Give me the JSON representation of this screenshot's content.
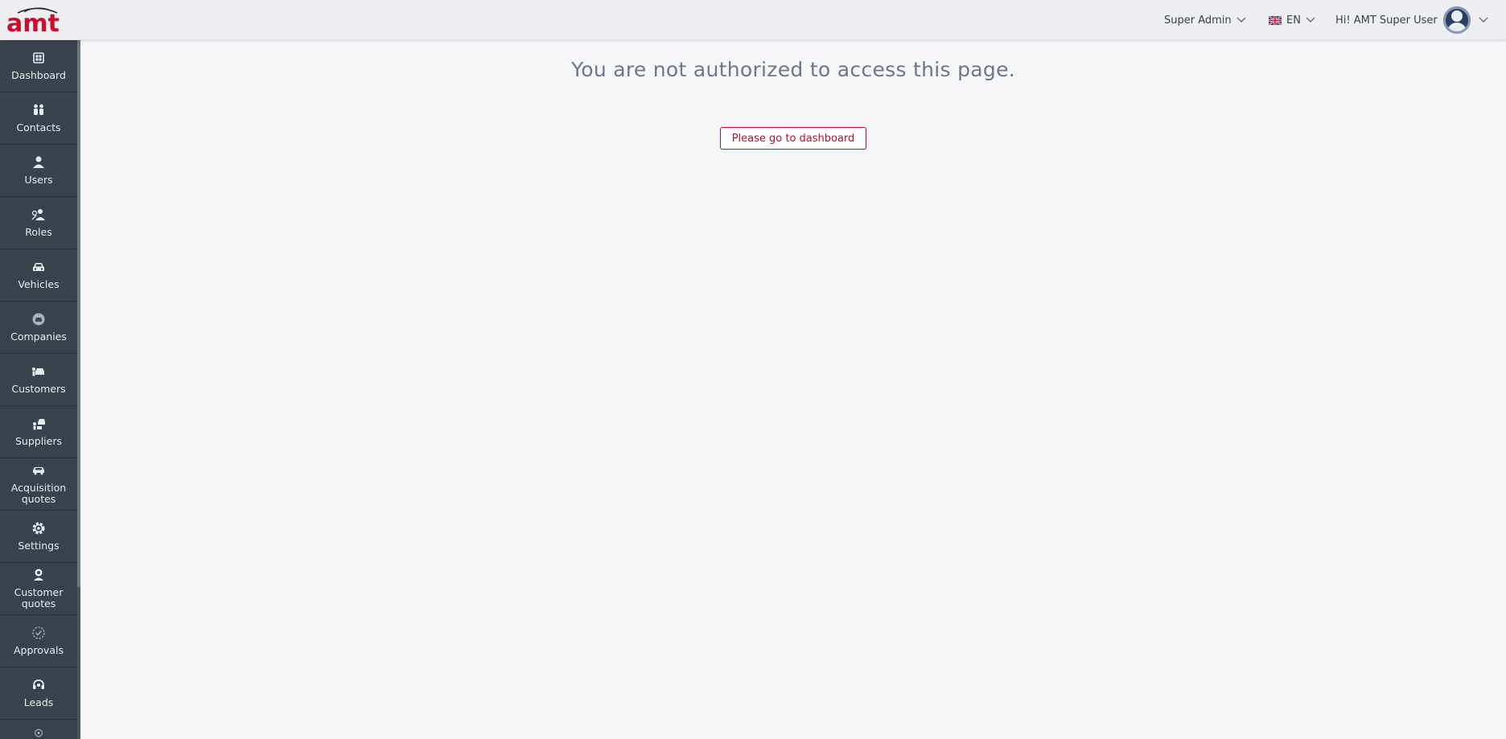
{
  "header": {
    "logo_text": "amt",
    "role_label": "Super Admin",
    "lang_label": "EN",
    "greeting": "Hi! AMT Super User"
  },
  "sidebar": {
    "items": [
      {
        "label": "Dashboard",
        "icon": "dashboard-icon"
      },
      {
        "label": "Contacts",
        "icon": "contacts-icon"
      },
      {
        "label": "Users",
        "icon": "user-icon"
      },
      {
        "label": "Roles",
        "icon": "roles-icon"
      },
      {
        "label": "Vehicles",
        "icon": "car-icon"
      },
      {
        "label": "Companies",
        "icon": "companies-icon"
      },
      {
        "label": "Customers",
        "icon": "customers-icon"
      },
      {
        "label": "Suppliers",
        "icon": "suppliers-icon"
      },
      {
        "label": "Acquisition quotes",
        "icon": "acquisition-icon"
      },
      {
        "label": "Settings",
        "icon": "gear-icon"
      },
      {
        "label": "Customer quotes",
        "icon": "customer-quotes-icon"
      },
      {
        "label": "Approvals",
        "icon": "approval-icon"
      },
      {
        "label": "Leads",
        "icon": "headset-icon"
      }
    ]
  },
  "main": {
    "message": "You are not authorized to access this page.",
    "dashboard_button": "Please go to dashboard"
  },
  "colors": {
    "brand": "#b0122f",
    "sidebar_bg": "#3a424d",
    "page_bg": "#f5f6f8"
  }
}
